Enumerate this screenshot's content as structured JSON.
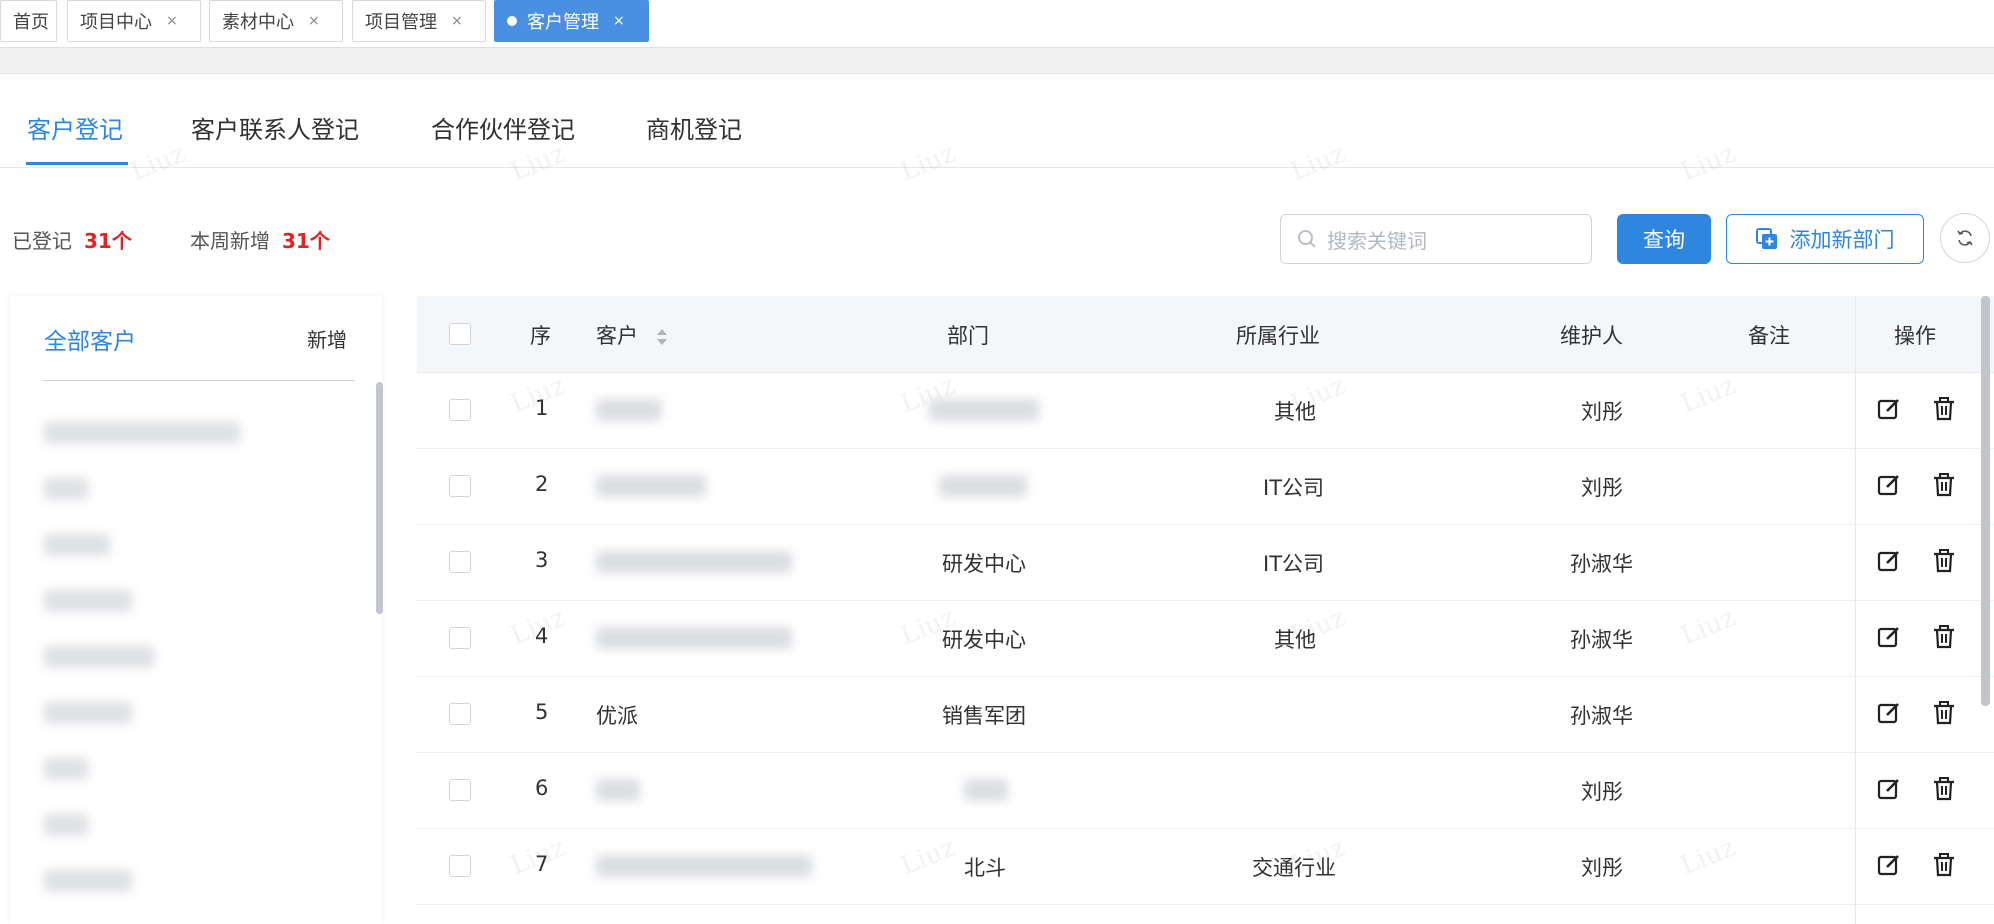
{
  "tabs": [
    {
      "label": "首页",
      "closable": false,
      "active": false
    },
    {
      "label": "项目中心",
      "closable": true,
      "active": false
    },
    {
      "label": "素材中心",
      "closable": true,
      "active": false
    },
    {
      "label": "项目管理",
      "closable": true,
      "active": false
    },
    {
      "label": "客户管理",
      "closable": true,
      "active": true
    }
  ],
  "close_glyph": "×",
  "subtabs": [
    "客户登记",
    "客户联系人登记",
    "合作伙伴登记",
    "商机登记"
  ],
  "stats": {
    "registered_label": "已登记",
    "registered_value": "31个",
    "weekly_label": "本周新增",
    "weekly_value": "31个"
  },
  "search": {
    "placeholder": "搜索关键词"
  },
  "buttons": {
    "query": "查询",
    "add_department": "添加新部门"
  },
  "sidebar": {
    "title": "全部客户",
    "add": "新增"
  },
  "table": {
    "headers": {
      "index": "序",
      "customer": "客户",
      "department": "部门",
      "industry": "所属行业",
      "maintainer": "维护人",
      "remark": "备注",
      "actions": "操作"
    },
    "rows": [
      {
        "index": "1",
        "customer": "",
        "department": "",
        "industry": "其他",
        "maintainer": "刘彤"
      },
      {
        "index": "2",
        "customer": "",
        "department": "",
        "industry": "IT公司",
        "maintainer": "刘彤"
      },
      {
        "index": "3",
        "customer": "",
        "department": "研发中心",
        "industry": "IT公司",
        "maintainer": "孙淑华"
      },
      {
        "index": "4",
        "customer": "",
        "department": "研发中心",
        "industry": "其他",
        "maintainer": "孙淑华"
      },
      {
        "index": "5",
        "customer": "优派",
        "department": "销售军团",
        "industry": "",
        "maintainer": "孙淑华"
      },
      {
        "index": "6",
        "customer": "",
        "department": "",
        "industry": "",
        "maintainer": "刘彤"
      },
      {
        "index": "7",
        "customer": "",
        "department": "北斗",
        "industry": "交通行业",
        "maintainer": "刘彤"
      }
    ]
  },
  "watermark": "Liuz",
  "colors": {
    "accent": "#2e86de",
    "stat_number": "#e02424",
    "active_tab": "#4a90e2"
  }
}
